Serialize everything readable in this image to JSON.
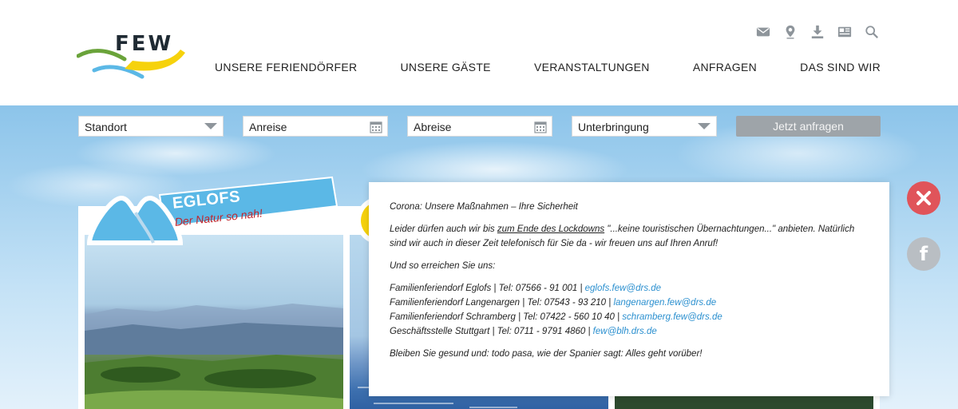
{
  "brand": {
    "logo_text": "FEW"
  },
  "header": {
    "utility_icons": [
      "mail-icon",
      "location-pin-icon",
      "download-icon",
      "newspaper-icon",
      "search-icon"
    ],
    "nav": [
      "UNSERE FERIENDÖRFER",
      "UNSERE GÄSTE",
      "VERANSTALTUNGEN",
      "ANFRAGEN",
      "DAS SIND WIR"
    ]
  },
  "search": {
    "standort": "Standort",
    "anreise": "Anreise",
    "abreise": "Abreise",
    "unterbringung": "Unterbringung",
    "submit": "Jetzt anfragen"
  },
  "cards": {
    "eglofs": {
      "title": "EGLOFS",
      "subtitle": "Der Natur so nah!"
    }
  },
  "notice": {
    "title": "Corona: Unsere Maßnahmen – Ihre Sicherheit",
    "p1_before": "Leider dürfen auch wir bis ",
    "p1_link": "zum Ende des Lockdowns",
    "p1_after": " \"...keine touristischen Übernachtungen...\" anbieten. Natürlich sind wir auch in dieser Zeit telefonisch für Sie da - wir freuen uns auf Ihren Anruf!",
    "p2": "Und so erreichen Sie uns:",
    "contacts": [
      {
        "text": "Familienferiendorf Eglofs | Tel: 07566 - 91 001 | ",
        "email": "eglofs.few@drs.de"
      },
      {
        "text": "Familienferiendorf Langenargen | Tel: 07543 - 93 210 | ",
        "email": "langenargen.few@drs.de"
      },
      {
        "text": "Familienferiendorf Schramberg | Tel: 07422 - 560 10 40 | ",
        "email": "schramberg.few@drs.de"
      },
      {
        "text": "Geschäftsstelle Stuttgart | Tel: 0711 - 9791 4860 | ",
        "email": "few@blh.drs.de"
      }
    ],
    "closing": "Bleiben Sie gesund und: todo pasa, wie der Spanier sagt: Alles geht vorüber!"
  },
  "side": {
    "close_icon": "close-icon",
    "facebook_label": "f"
  },
  "colors": {
    "accent_blue": "#5bb8e6",
    "accent_yellow": "#f6d20c",
    "accent_green": "#6aa33a",
    "link": "#2a8fcf",
    "close_red": "#e0545a"
  }
}
